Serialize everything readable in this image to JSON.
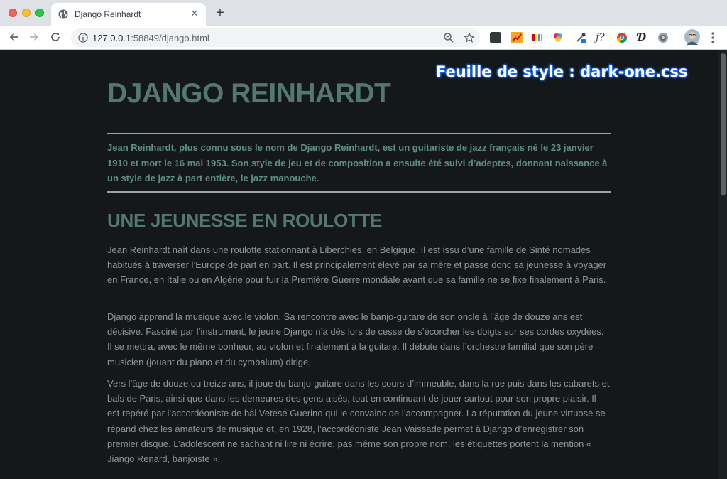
{
  "browser": {
    "tab": {
      "title": "Django Reinhardt"
    },
    "address": {
      "host": "127.0.0.1",
      "path": ":58849/django.html"
    }
  },
  "page": {
    "stylesheet_label": "Feuille de style : dark-one.css",
    "title": "DJANGO REINHARDT",
    "intro": "Jean Reinhardt, plus connu sous le nom de Django Reinhardt, est un guitariste de jazz français né le 23 janvier 1910 et mort le 16 mai 1953. Son style de jeu et de composition a ensuite été suivi d’adeptes, donnant naissance à un style de jazz à part entière, le jazz manouche.",
    "section_title": "UNE JEUNESSE EN ROULOTTE",
    "paragraphs": [
      "Jean Reinhardt naît dans une roulotte stationnant à Liberchies, en Belgique. Il est issu d’une famille de Sinté nomades habitués à traverser l’Europe de part en part. Il est principalement élevé par sa mère et passe donc sa jeunesse à voyager en France, en Italie ou en Algérie pour fuir la Première Guerre mondiale avant que sa famille ne se fixe finalement à Paris.",
      "Django apprend la musique avec le violon. Sa rencontre avec le banjo-guitare de son oncle à l’âge de douze ans est décisive. Fasciné par l’instrument, le jeune Django n’a dès lors de cesse de s’écorcher les doigts sur ses cordes oxydées. Il se mettra, avec le même bonheur, au violon et finalement à la guitare. Il débute dans l’orchestre familial que son père musicien (jouant du piano et du cymbalum) dirige.",
      "Vers l’âge de douze ou treize ans, il joue du banjo-guitare dans les cours d’immeuble, dans la rue puis dans les cabarets et bals de Paris, ainsi que dans les demeures des gens aisés, tout en continuant de jouer surtout pour son propre plaisir. Il est repéré par l’accordéoniste de bal Vetese Guerino qui le convainc de l’accompagner. La réputation du jeune virtuose se répand chez les amateurs de musique et, en 1928, l’accordéoniste Jean Vaissade permet à Django d’enregistrer son premier disque. L’adolescent ne sachant ni lire ni écrire, pas même son propre nom, les étiquettes portent la mention « Jiango Renard, banjoïste »."
    ]
  }
}
